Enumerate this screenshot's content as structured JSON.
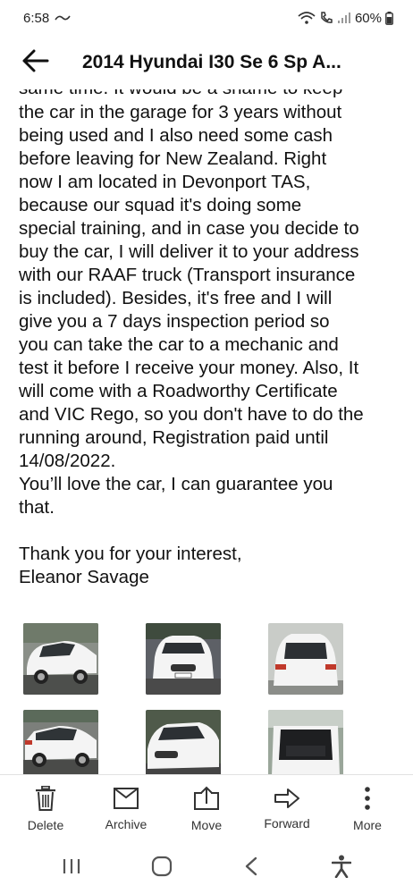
{
  "status_bar": {
    "time": "6:58",
    "battery": "60%"
  },
  "app_bar": {
    "title": "2014 Hyundai I30 Se 6 Sp A..."
  },
  "message": {
    "cut_line": "same time. It would be a shame to keep",
    "lines": [
      "the car in the garage for 3 years without",
      "being used and I also need some cash",
      "before leaving for New Zealand. Right",
      "now I am located in Devonport TAS,",
      "because our squad it's doing some",
      "special training, and in case you decide to",
      "buy the car, I will deliver it to your address",
      "with our RAAF truck (Transport insurance",
      "is included). Besides, it's free and I will",
      "give you a 7 days inspection period so",
      "you can take the car to a mechanic and",
      "test it before I receive your money. Also, It",
      "will come with a Roadworthy Certificate",
      "and VIC Rego, so you don't have to do the",
      "running around, Registration paid until",
      "14/08/2022.",
      "You’ll love the car, I can guarantee you",
      "that.",
      "",
      "Thank you for your interest,",
      "Eleanor Savage"
    ]
  },
  "photos": {
    "count": 6,
    "car_color": "#f4f4f4",
    "rows": [
      [
        "car-side-front-photo",
        "car-front-photo",
        "car-rear-photo"
      ],
      [
        "car-side-rear-photo",
        "car-front-angle-photo",
        "car-boot-open-photo"
      ]
    ]
  },
  "actions": [
    {
      "label": "Delete",
      "icon": "trash-icon"
    },
    {
      "label": "Archive",
      "icon": "archive-icon"
    },
    {
      "label": "Move",
      "icon": "move-icon"
    },
    {
      "label": "Forward",
      "icon": "forward-arrow-icon"
    },
    {
      "label": "More",
      "icon": "more-vertical-icon"
    }
  ],
  "nav": [
    "recent-apps-icon",
    "home-icon",
    "back-chevron-icon",
    "accessibility-icon"
  ],
  "colors": {
    "text": "#111111",
    "icon": "#333333",
    "divider": "#e2e2e2"
  }
}
